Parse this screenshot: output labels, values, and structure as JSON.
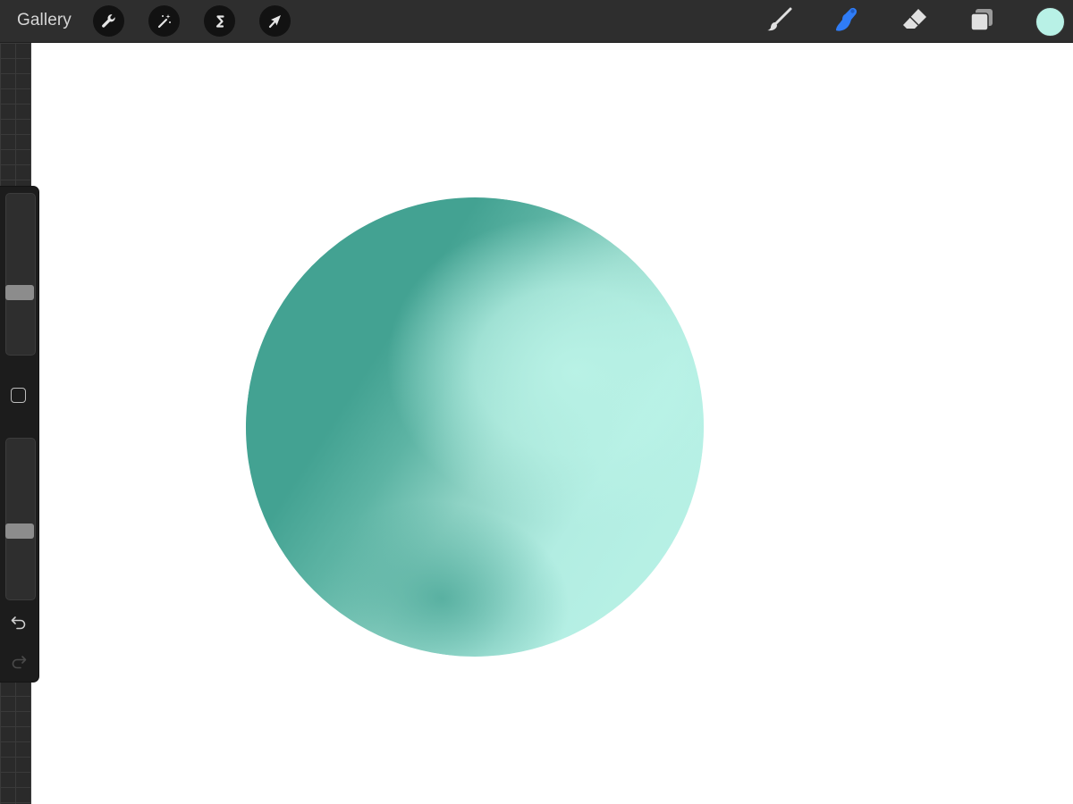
{
  "app": {
    "gallery_label": "Gallery"
  },
  "toolbar": {
    "left_tools": [
      {
        "name": "actions",
        "icon": "wrench-icon"
      },
      {
        "name": "adjustments",
        "icon": "magic-wand-icon"
      },
      {
        "name": "selection",
        "icon": "selection-s-icon"
      },
      {
        "name": "transform",
        "icon": "arrow-cursor-icon"
      }
    ],
    "right_tools": [
      {
        "name": "brush",
        "icon": "brush-icon",
        "active": false
      },
      {
        "name": "smudge",
        "icon": "smudge-finger-icon",
        "active": true
      },
      {
        "name": "eraser",
        "icon": "eraser-icon",
        "active": false
      },
      {
        "name": "layers",
        "icon": "layers-icon",
        "active": false
      }
    ],
    "active_tool_color": "#2f7cf6",
    "current_color": "#b8f1e6"
  },
  "sidebar": {
    "brush_size_level": 0.37,
    "opacity_level": 0.41,
    "modifier_icon": "square-modifier-icon",
    "undo_icon": "undo-icon",
    "redo_icon": "redo-icon",
    "redo_enabled": false
  },
  "canvas": {
    "background": "#ffffff",
    "sphere_dark": "#43a292",
    "sphere_light": "#baf3e7"
  }
}
